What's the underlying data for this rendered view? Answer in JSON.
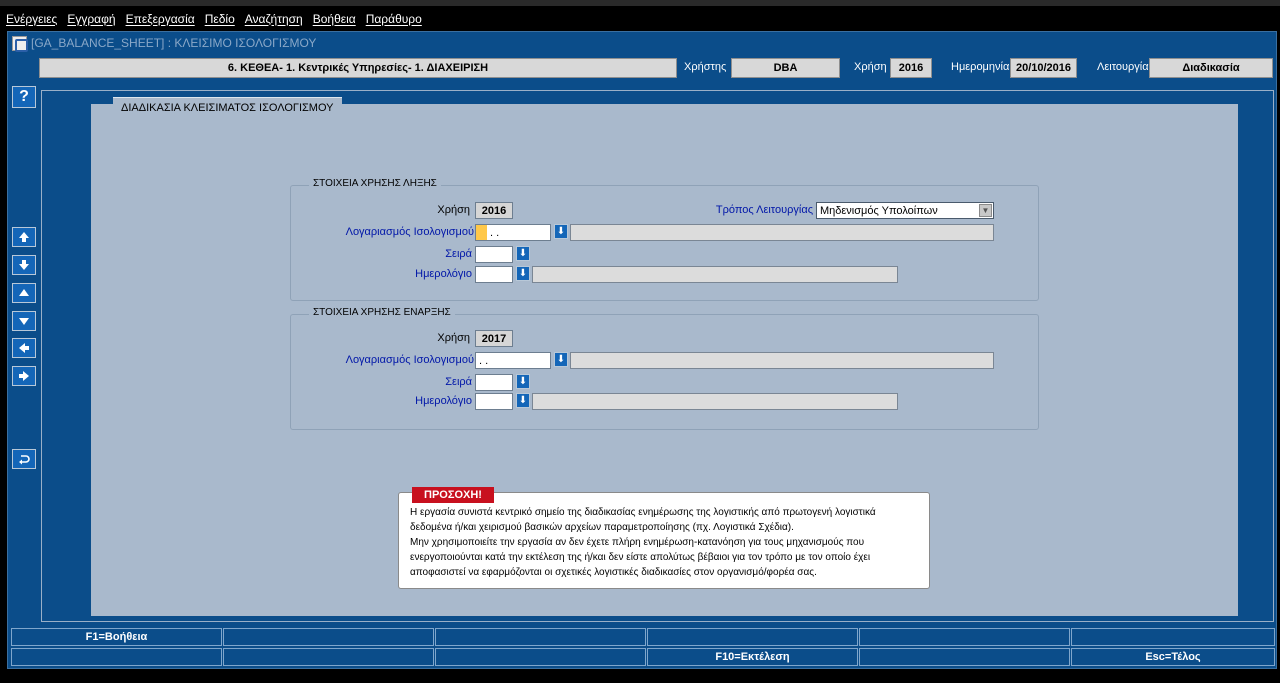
{
  "menu": [
    "Ενέργειες",
    "Εγγραφή",
    "Επεξεργασία",
    "Πεδίο",
    "Αναζήτηση",
    "Βοήθεια",
    "Παράθυρο"
  ],
  "window": {
    "title": "[GA_BALANCE_SHEET]  :  ΚΛΕΙΣΙΜΟ ΙΣΟΛΟΓΙΣΜΟΥ"
  },
  "header": {
    "company": "6. ΚΕΘΕΑ- 1. Κεντρικές Υπηρεσίες- 1. ΔΙΑΧΕΙΡΙΣΗ",
    "user_label": "Χρήστης",
    "user": "DBA",
    "year_label": "Χρήση",
    "year": "2016",
    "date_label": "Ημερομηνία",
    "date": "20/10/2016",
    "function_label": "Λειτουργία",
    "function": "Διαδικασία"
  },
  "sidebar": {
    "help": "?"
  },
  "panel": {
    "title": "ΔΙΑΔΙΚΑΣΙΑ ΚΛΕΙΣΙΜΑΤΟΣ ΙΣΟΛΟΓΙΣΜΟΥ"
  },
  "closing": {
    "title": "ΣΤΟΙΧΕΙΑ ΧΡΗΣΗΣ ΛΗΞΗΣ",
    "year_label": "Χρήση",
    "year": "2016",
    "mode_label": "Τρόπος Λειτουργίας",
    "mode": "Μηδενισμός Υπολοίπων",
    "account_label": "Λογαριασμός Ισολογισμού",
    "account": " .  .",
    "series_label": "Σειρά",
    "journal_label": "Ημερολόγιο"
  },
  "opening": {
    "title": "ΣΤΟΙΧΕΙΑ ΧΡΗΣΗΣ ΕΝΑΡΞΗΣ",
    "year_label": "Χρήση",
    "year": "2017",
    "account_label": "Λογαριασμός Ισολογισμού",
    "account": " .  .",
    "series_label": "Σειρά",
    "journal_label": "Ημερολόγιο"
  },
  "warning": {
    "title": "ΠΡΟΣΟΧΗ!",
    "lines": [
      "Η εργασία συνιστά κεντρικό σημείο της διαδικασίας ενημέρωσης της λογιστικής από πρωτογενή λογιστικά",
      "δεδομένα ή/και χειρισμού βασικών αρχείων παραμετροποίησης (πχ. Λογιστικά Σχέδια).",
      "Μην χρησιμοποιείτε την εργασία αν δεν έχετε πλήρη ενημέρωση-κατανόηση για τους μηχανισμούς που",
      "ενεργοποιούνται κατά την εκτέλεση της ή/και δεν είστε απολύτως βέβαιοι για τον τρόπο με τον οποίο έχει",
      "αποφασιστεί να εφαρμόζονται οι σχετικές λογιστικές διαδικασίες στον οργανισμό/φορέα σας."
    ]
  },
  "fkeys": {
    "row1": [
      "F1=Βοήθεια",
      "",
      "",
      "",
      "",
      ""
    ],
    "row2": [
      "",
      "",
      "",
      "F10=Εκτέλεση",
      "",
      "Esc=Τέλος"
    ]
  }
}
